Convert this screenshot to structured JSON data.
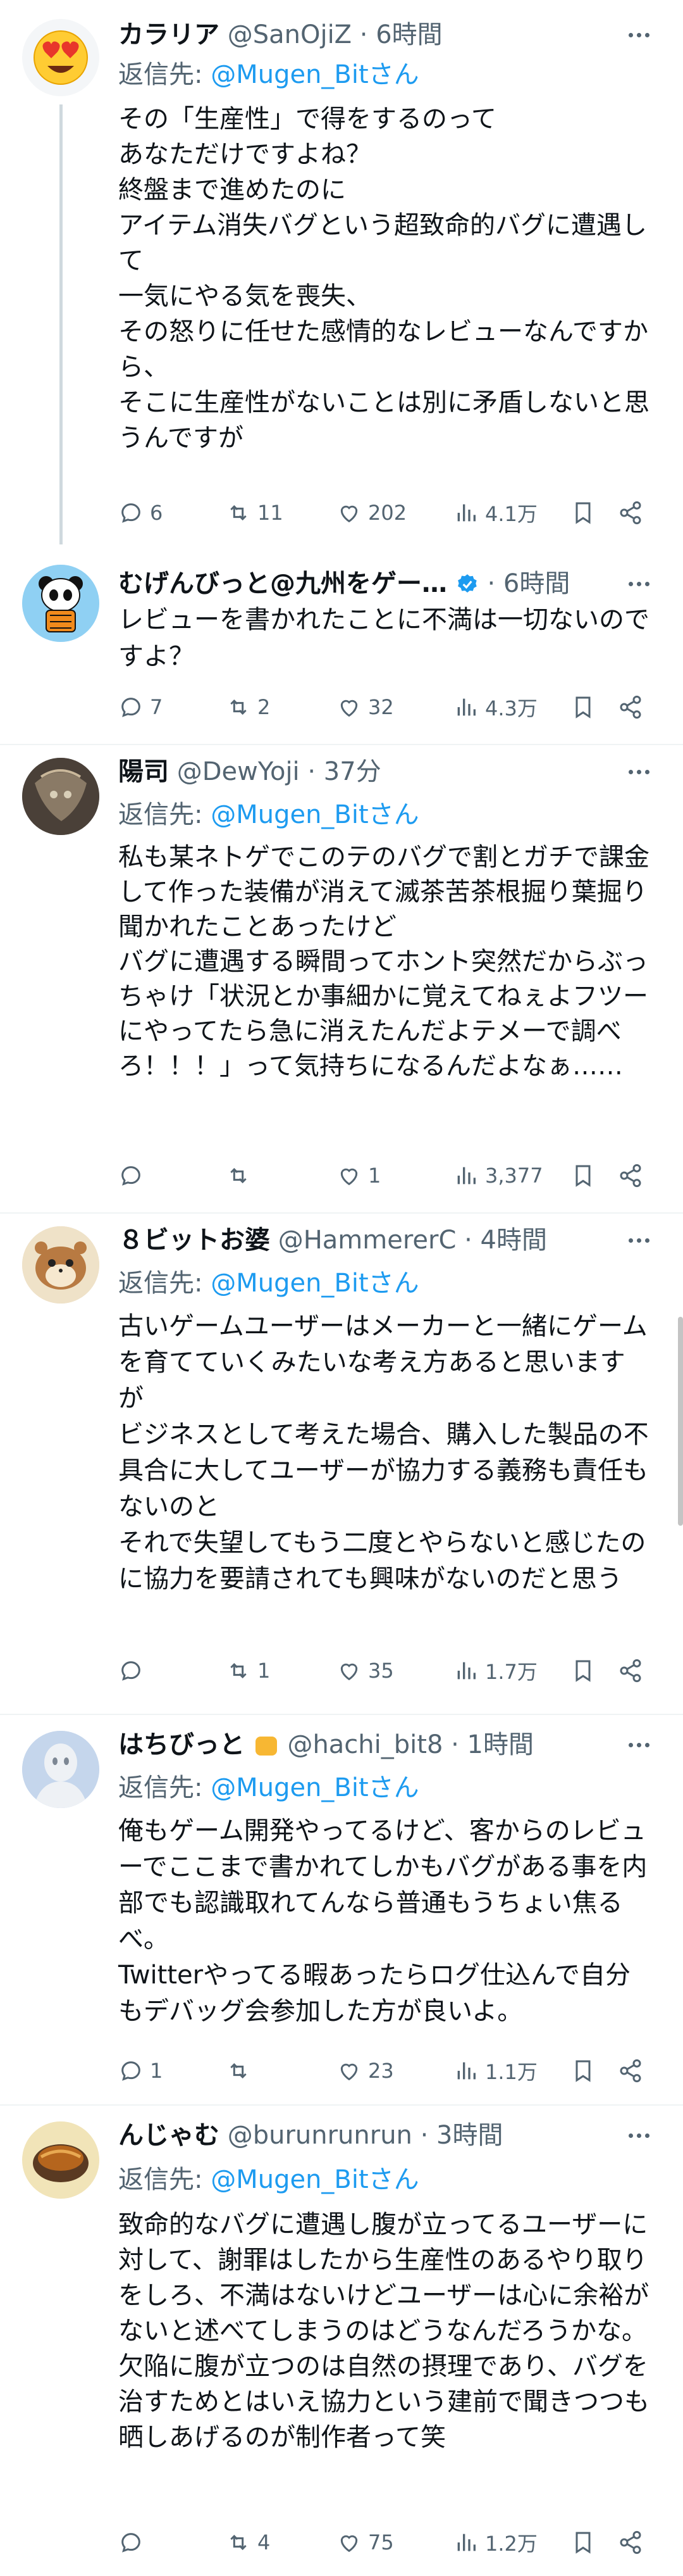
{
  "tweets": [
    {
      "name": "カラリア",
      "handle": "@SanOjiZ · 6時間",
      "reply_prefix": "返信先: ",
      "reply_to": "@Mugen_Bitさん",
      "text": "その「生産性」で得をするのって\nあなただけですよね？\n終盤まで進めたのに\nアイテム消失バグという超致命的バグに遭遇して\n一気にやる気を喪失、\nその怒りに任せた感情的なレビューなんですから、\nそこに生産性がないことは別に矛盾しないと思うんですが",
      "replies": "6",
      "retweets": "11",
      "likes": "202",
      "views": "4.1万"
    },
    {
      "name": "むげんびっと@九州をゲー…",
      "handle": "· 6時間",
      "text": "レビューを書かれたことに不満は一切ないのですよ？",
      "replies": "7",
      "retweets": "2",
      "likes": "32",
      "views": "4.3万"
    },
    {
      "name": "陽司",
      "handle": "@DewYoji · 37分",
      "reply_prefix": "返信先: ",
      "reply_to": "@Mugen_Bitさん",
      "text": "私も某ネトゲでこのテのバグで割とガチで課金して作った装備が消えて滅茶苦茶根掘り葉掘り聞かれたことあったけど\nバグに遭遇する瞬間ってホント突然だからぶっちゃけ「状況とか事細かに覚えてねぇよフツーにやってたら急に消えたんだよテメーで調べろ！！！」って気持ちになるんだよなぁ……",
      "replies": "",
      "retweets": "",
      "likes": "1",
      "views": "3,377"
    },
    {
      "name": "８ビットお婆",
      "handle": "@HammererC · 4時間",
      "reply_prefix": "返信先: ",
      "reply_to": "@Mugen_Bitさん",
      "text": "古いゲームユーザーはメーカーと一緒にゲームを育てていくみたいな考え方あると思いますが\nビジネスとして考えた場合、購入した製品の不具合に大してユーザーが協力する義務も責任もないのと\nそれで失望してもう二度とやらないと感じたのに協力を要請されても興味がないのだと思う",
      "replies": "",
      "retweets": "1",
      "likes": "35",
      "views": "1.7万"
    },
    {
      "name": "はちびっと",
      "handle": "@hachi_bit8 · 1時間",
      "reply_prefix": "返信先: ",
      "reply_to": "@Mugen_Bitさん",
      "text": "俺もゲーム開発やってるけど、客からのレビューでここまで書かれてしかもバグがある事を内部でも認識取れてんなら普通もうちょい焦るべ。\nTwitterやってる暇あったらログ仕込んで自分もデバッグ会参加した方が良いよ。",
      "replies": "1",
      "retweets": "",
      "likes": "23",
      "views": "1.1万"
    },
    {
      "name": "んじゃむ",
      "handle": "@burunrunrun · 3時間",
      "reply_prefix": "返信先: ",
      "reply_to": "@Mugen_Bitさん",
      "text": "致命的なバグに遭遇し腹が立ってるユーザーに対して、謝罪はしたから生産性のあるやり取りをしろ、不満はないけどユーザーは心に余裕がないと述べてしまうのはどうなんだろうかな。\n欠陥に腹が立つのは自然の摂理であり、バグを治すためとはいえ協力という建前で聞きつつも晒しあげるのが制作者って笑",
      "replies": "",
      "retweets": "4",
      "likes": "75",
      "views": "1.2万"
    }
  ],
  "colors": {
    "link": "#1d9bf0",
    "muted": "#536471",
    "verified": "#1d9bf0"
  },
  "icons": [
    "reply-icon",
    "retweet-icon",
    "like-icon",
    "views-icon",
    "bookmark-icon",
    "share-icon",
    "more-icon",
    "verified-badge-icon"
  ]
}
